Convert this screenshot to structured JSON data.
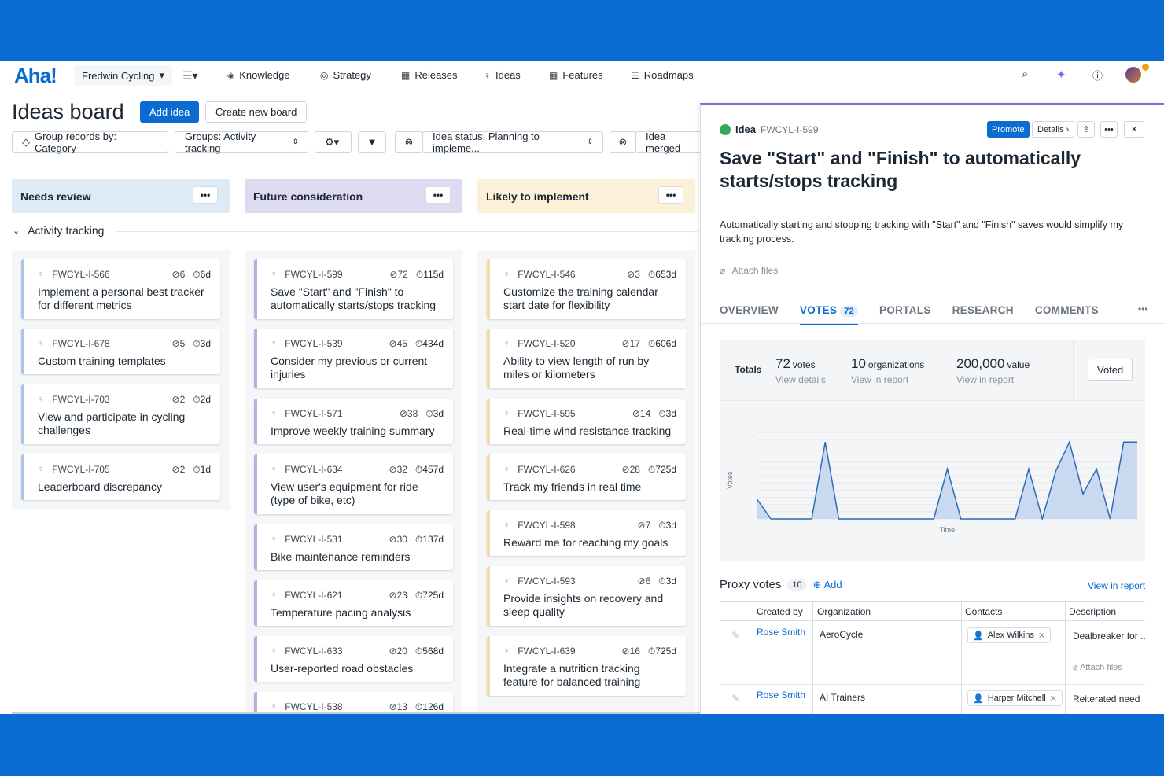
{
  "nav": {
    "logo": "Aha!",
    "workspace": "Fredwin Cycling",
    "items": [
      {
        "label": "Knowledge",
        "icon": "knowledge-icon"
      },
      {
        "label": "Strategy",
        "icon": "strategy-icon"
      },
      {
        "label": "Releases",
        "icon": "releases-icon"
      },
      {
        "label": "Ideas",
        "icon": "ideas-icon"
      },
      {
        "label": "Features",
        "icon": "features-icon"
      },
      {
        "label": "Roadmaps",
        "icon": "roadmaps-icon"
      }
    ]
  },
  "header": {
    "title": "Ideas board",
    "add_idea": "Add idea",
    "create_board": "Create new board"
  },
  "toolbar": {
    "group_records": "Group records by: Category",
    "groups": "Groups: Activity tracking",
    "status_filter": "Idea status: Planning to impleme...",
    "merged_filter": "Idea merged"
  },
  "board": {
    "group_label": "Activity tracking",
    "columns": [
      {
        "name": "Needs review",
        "color": "#dfeaf7",
        "accent": "#a9c4e8",
        "cards": [
          {
            "key": "FWCYL-I-566",
            "votes": "6",
            "age": "6d",
            "title": "Implement a personal best tracker for different metrics"
          },
          {
            "key": "FWCYL-I-678",
            "votes": "5",
            "age": "3d",
            "title": "Custom training templates"
          },
          {
            "key": "FWCYL-I-703",
            "votes": "2",
            "age": "2d",
            "title": "View and participate in cycling challenges"
          },
          {
            "key": "FWCYL-I-705",
            "votes": "2",
            "age": "1d",
            "title": "Leaderboard discrepancy"
          }
        ]
      },
      {
        "name": "Future consideration",
        "color": "#dedbf1",
        "accent": "#b7b0e0",
        "cards": [
          {
            "key": "FWCYL-I-599",
            "votes": "72",
            "age": "115d",
            "title": "Save \"Start\" and \"Finish\" to automatically starts/stops tracking"
          },
          {
            "key": "FWCYL-I-539",
            "votes": "45",
            "age": "434d",
            "title": "Consider my previous or current injuries"
          },
          {
            "key": "FWCYL-I-571",
            "votes": "38",
            "age": "3d",
            "title": "Improve weekly training summary"
          },
          {
            "key": "FWCYL-I-634",
            "votes": "32",
            "age": "457d",
            "title": "View user's equipment for ride (type of bike, etc)"
          },
          {
            "key": "FWCYL-I-531",
            "votes": "30",
            "age": "137d",
            "title": "Bike maintenance reminders"
          },
          {
            "key": "FWCYL-I-621",
            "votes": "23",
            "age": "725d",
            "title": "Temperature pacing analysis"
          },
          {
            "key": "FWCYL-I-633",
            "votes": "20",
            "age": "568d",
            "title": "User-reported road obstacles"
          },
          {
            "key": "FWCYL-I-538",
            "votes": "13",
            "age": "126d",
            "title": ""
          }
        ]
      },
      {
        "name": "Likely to implement",
        "color": "#fcf1d8",
        "accent": "#f0dca4",
        "cards": [
          {
            "key": "FWCYL-I-546",
            "votes": "3",
            "age": "653d",
            "title": "Customize the training calendar start date for flexibility"
          },
          {
            "key": "FWCYL-I-520",
            "votes": "17",
            "age": "606d",
            "title": "Ability to view length of run by miles or kilometers"
          },
          {
            "key": "FWCYL-I-595",
            "votes": "14",
            "age": "3d",
            "title": "Real-time wind resistance tracking"
          },
          {
            "key": "FWCYL-I-626",
            "votes": "28",
            "age": "725d",
            "title": "Track my friends in real time"
          },
          {
            "key": "FWCYL-I-598",
            "votes": "7",
            "age": "3d",
            "title": "Reward me for reaching my goals"
          },
          {
            "key": "FWCYL-I-593",
            "votes": "6",
            "age": "3d",
            "title": "Provide insights on recovery and sleep quality"
          },
          {
            "key": "FWCYL-I-639",
            "votes": "16",
            "age": "725d",
            "title": "Integrate a nutrition tracking feature for balanced training"
          }
        ]
      }
    ]
  },
  "panel": {
    "type_label": "Idea",
    "key": "FWCYL-I-599",
    "promote": "Promote",
    "details": "Details",
    "title": "Save \"Start\" and \"Finish\" to automatically starts/stops tracking",
    "description": "Automatically starting and stopping tracking with \"Start\" and \"Finish\" saves would simplify my tracking process.",
    "attach": "Attach files",
    "tabs": [
      "OVERVIEW",
      "VOTES",
      "PORTALS",
      "RESEARCH",
      "COMMENTS"
    ],
    "votes_badge": "72",
    "totals": {
      "label": "Totals",
      "votes": "72",
      "votes_unit": "votes",
      "votes_sub": "View details",
      "orgs": "10",
      "orgs_unit": "organizations",
      "orgs_sub": "View in report",
      "value": "200,000",
      "value_unit": "value",
      "value_sub": "View in report",
      "voted": "Voted"
    },
    "proxy": {
      "title": "Proxy votes",
      "count": "10",
      "add": "Add",
      "view_report": "View in report",
      "headers": [
        "Created by",
        "Organization",
        "Contacts",
        "Description"
      ],
      "rows": [
        {
          "created_by": "Rose Smith",
          "organization": "AeroCycle",
          "contact": "Alex Wilkins",
          "description": "Dealbreaker for ...",
          "attach": "Attach files"
        },
        {
          "created_by": "Rose Smith",
          "organization": "AI Trainers",
          "contact": "Harper Mitchell",
          "description": "Reiterated need"
        }
      ]
    }
  },
  "chart_data": {
    "type": "area",
    "title": "",
    "xlabel": "Time",
    "ylabel": "Votes",
    "grid": true,
    "color": "#a9c4e8",
    "values": [
      1,
      0,
      0,
      0,
      0,
      4,
      0,
      0,
      0,
      0,
      0,
      0,
      0,
      0,
      2.6,
      0,
      0,
      0,
      0,
      0,
      2.6,
      0,
      2.5,
      4,
      1.3,
      2.6,
      0,
      4,
      4
    ],
    "ylim": [
      0,
      4.5
    ]
  }
}
